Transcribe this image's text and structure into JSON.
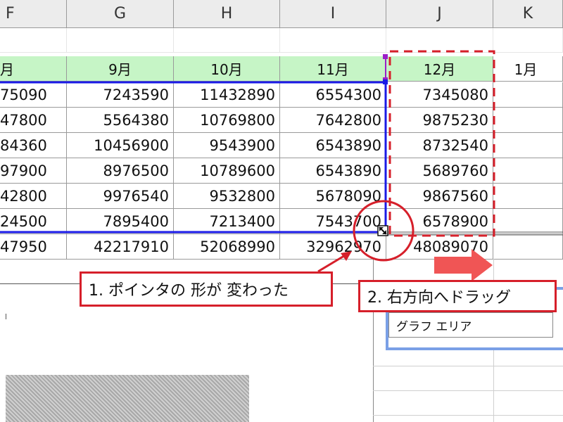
{
  "columns": [
    "F",
    "G",
    "H",
    "I",
    "J",
    "K"
  ],
  "months": [
    "月",
    "9月",
    "10月",
    "11月",
    "12月",
    "1月"
  ],
  "rows": [
    [
      "75090",
      "7243590",
      "11432890",
      "6554300",
      "7345080"
    ],
    [
      "47800",
      "5564380",
      "10769800",
      "7642800",
      "9875230"
    ],
    [
      "84360",
      "10456900",
      "9543900",
      "6543890",
      "8732540"
    ],
    [
      "97900",
      "8976500",
      "10789600",
      "6543890",
      "5689760"
    ],
    [
      "42800",
      "9976540",
      "9532800",
      "5678090",
      "9867560"
    ],
    [
      "24500",
      "7895400",
      "7213400",
      "7543700",
      "6578900"
    ]
  ],
  "totals": [
    "47950",
    "42217910",
    "52068990",
    "32962970",
    "48089070"
  ],
  "callouts": {
    "pointer": "1. ポインタの 形が 変わった",
    "drag": "2. 右方向へドラッグ"
  },
  "chart": {
    "label": "グラフ エリア"
  },
  "colors": {
    "header_fill": "#c6f5c6",
    "selection_blue": "#1a1ae6",
    "annotation_red": "#d61f2a"
  }
}
